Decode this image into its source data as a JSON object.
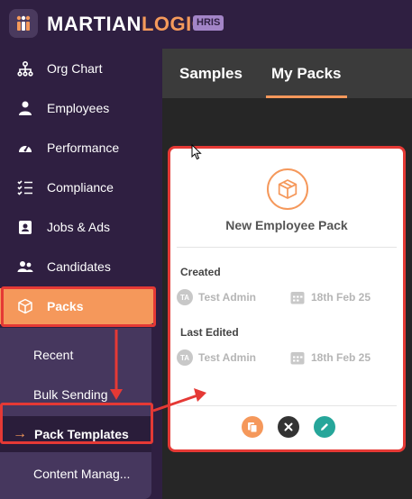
{
  "brand": {
    "name_part1": "MARTIAN",
    "name_part2": "LOGIC",
    "badge": "HRIS"
  },
  "colors": {
    "accent": "#f5985b",
    "sidebar": "#2f1f41",
    "submenu": "#46375e",
    "highlight": "#e53935",
    "delete": "#333333",
    "edit": "#26a69a"
  },
  "sidebar": {
    "items": [
      {
        "label": "Org Chart",
        "icon": "org-chart-icon"
      },
      {
        "label": "Employees",
        "icon": "person-icon"
      },
      {
        "label": "Performance",
        "icon": "gauge-icon"
      },
      {
        "label": "Compliance",
        "icon": "checklist-icon"
      },
      {
        "label": "Jobs & Ads",
        "icon": "id-badge-icon"
      },
      {
        "label": "Candidates",
        "icon": "people-icon"
      },
      {
        "label": "Packs",
        "icon": "box-icon"
      }
    ],
    "active": "Packs",
    "submenu": [
      {
        "label": "Recent"
      },
      {
        "label": "Bulk Sending"
      },
      {
        "label": "Pack Templates"
      },
      {
        "label": "Content Manag..."
      }
    ],
    "submenu_active": "Pack Templates"
  },
  "tabs": [
    {
      "label": "Samples"
    },
    {
      "label": "My Packs"
    }
  ],
  "tabs_active": "My Packs",
  "card": {
    "title": "New Employee Pack",
    "created": {
      "label": "Created",
      "initials": "TA",
      "user": "Test Admin",
      "date": "18th Feb 25"
    },
    "edited": {
      "label": "Last Edited",
      "initials": "TA",
      "user": "Test Admin",
      "date": "18th Feb 25"
    },
    "actions": [
      "copy-icon",
      "delete-icon",
      "edit-icon"
    ]
  }
}
